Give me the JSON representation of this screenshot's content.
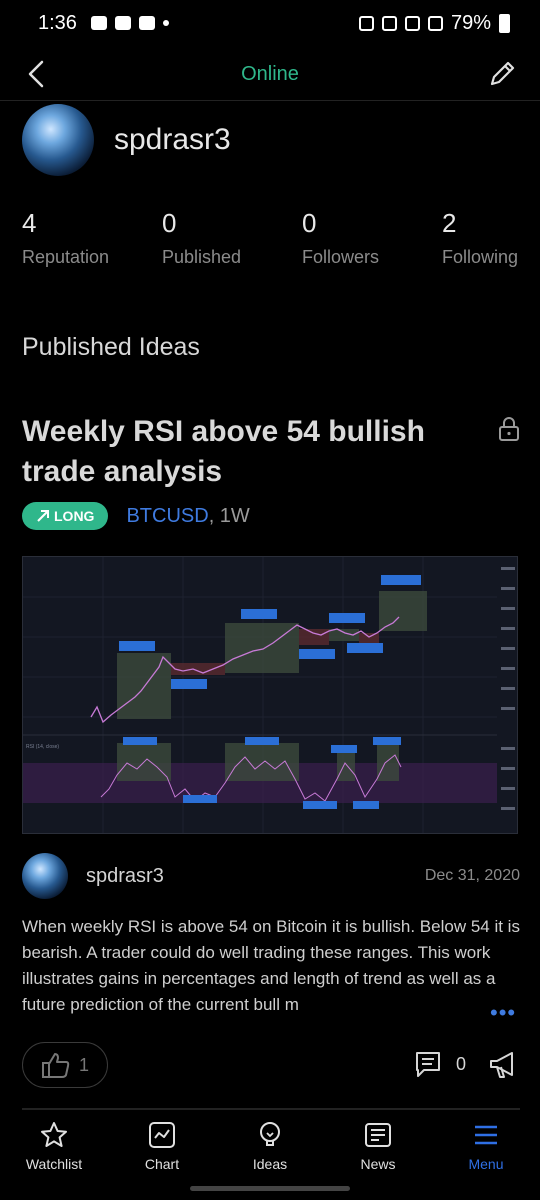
{
  "status_bar": {
    "time": "1:36",
    "battery": "79%"
  },
  "header": {
    "title": "Online"
  },
  "profile": {
    "username": "spdrasr3"
  },
  "stats": [
    {
      "value": "4",
      "label": "Reputation"
    },
    {
      "value": "0",
      "label": "Published"
    },
    {
      "value": "0",
      "label": "Followers"
    },
    {
      "value": "2",
      "label": "Following"
    }
  ],
  "section_title": "Published Ideas",
  "idea": {
    "title": "Weekly RSI above 54 bullish trade analysis",
    "badge": "LONG",
    "symbol": "BTCUSD",
    "interval": ", 1W",
    "author": "spdrasr3",
    "date": "Dec 31, 2020",
    "description": "When weekly RSI is above 54 on Bitcoin it is bullish. Below 54 it is bearish. A trader could do well trading these ranges. This work illustrates gains in percentages and length of trend as well as a future prediction of the current bull m",
    "more": "•••",
    "likes": "1",
    "comments": "0",
    "chart_thumbnail_text": {
      "rsi_label": "RSI (14, close)"
    }
  },
  "nav": [
    {
      "label": "Watchlist",
      "icon": "star-icon"
    },
    {
      "label": "Chart",
      "icon": "chart-icon"
    },
    {
      "label": "Ideas",
      "icon": "lightbulb-icon"
    },
    {
      "label": "News",
      "icon": "news-icon"
    },
    {
      "label": "Menu",
      "icon": "menu-icon"
    }
  ],
  "colors": {
    "accent": "#2fb78b",
    "link": "#3f7be0",
    "active_nav": "#2f6fe4",
    "background": "#000000"
  }
}
